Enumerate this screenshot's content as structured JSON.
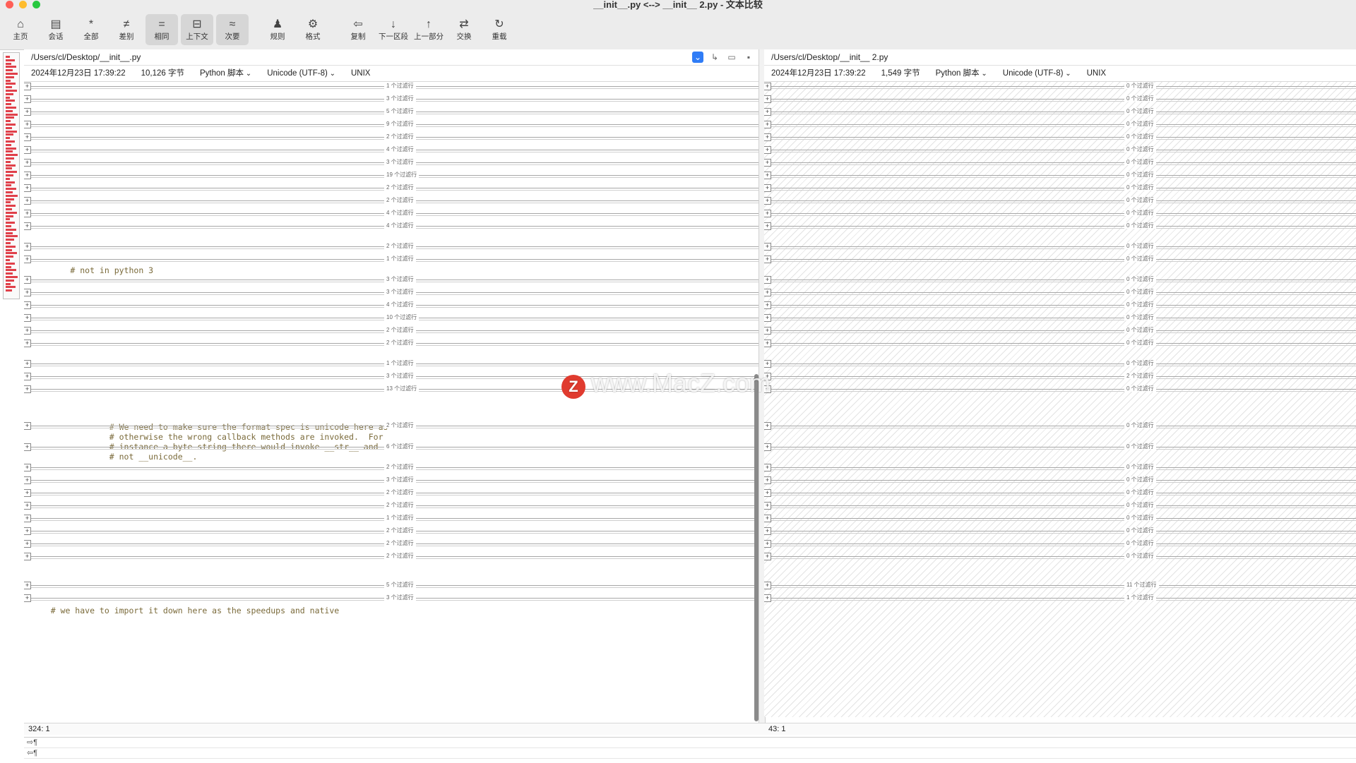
{
  "window": {
    "title": "__init__.py <--> __init__ 2.py - 文本比较"
  },
  "toolbar": [
    {
      "label": "主页",
      "icon": "home-icon",
      "glyph": "⌂",
      "active": false
    },
    {
      "label": "会话",
      "icon": "briefcase-icon",
      "glyph": "▤",
      "active": false
    },
    {
      "label": "全部",
      "icon": "asterisk-icon",
      "glyph": "*",
      "active": false
    },
    {
      "label": "差别",
      "icon": "not-equal-icon",
      "glyph": "≠",
      "active": false
    },
    {
      "label": "相同",
      "icon": "equal-icon",
      "glyph": "=",
      "active": true
    },
    {
      "label": "上下文",
      "icon": "context-icon",
      "glyph": "⊟",
      "active": true
    },
    {
      "label": "次要",
      "icon": "approx-icon",
      "glyph": "≈",
      "active": true
    },
    {
      "label": "规则",
      "icon": "rules-icon",
      "glyph": "♟",
      "active": false
    },
    {
      "label": "格式",
      "icon": "format-icon",
      "glyph": "⚙",
      "active": false
    },
    {
      "label": "复制",
      "icon": "copy-left-icon",
      "glyph": "⇦",
      "active": false
    },
    {
      "label": "下一区段",
      "icon": "arrow-down-icon",
      "glyph": "↓",
      "active": false
    },
    {
      "label": "上一部分",
      "icon": "arrow-up-icon",
      "glyph": "↑",
      "active": false
    },
    {
      "label": "交换",
      "icon": "swap-icon",
      "glyph": "⇄",
      "active": false
    },
    {
      "label": "重载",
      "icon": "reload-icon",
      "glyph": "↻",
      "active": false
    }
  ],
  "left": {
    "path": "/Users/cl/Desktop/__init__.py",
    "date": "2024年12月23日 17:39:22",
    "size": "10,126 字节",
    "format": "Python 脚本",
    "encoding": "Unicode (UTF-8)",
    "lineend": "UNIX",
    "status": "324: 1"
  },
  "right": {
    "path": "/Users/cl/Desktop/__init__ 2.py",
    "date": "2024年12月23日 17:39:22",
    "size": "1,549 字节",
    "format": "Python 脚本",
    "encoding": "Unicode (UTF-8)",
    "lineend": "UNIX",
    "status": "43: 1"
  },
  "left_folds": [
    "1 个过滤行",
    "3 个过滤行",
    "5 个过滤行",
    "9 个过滤行",
    "2 个过滤行",
    "4 个过滤行",
    "3 个过滤行",
    "19 个过滤行",
    "2 个过滤行",
    "2 个过滤行",
    "4 个过滤行",
    "4 个过滤行",
    "2 个过滤行",
    "1 个过滤行",
    "3 个过滤行",
    "3 个过滤行",
    "4 个过滤行",
    "10 个过滤行",
    "2 个过滤行",
    "2 个过滤行",
    "1 个过滤行",
    "3 个过滤行",
    "13 个过滤行",
    "2 个过滤行",
    "6 个过滤行",
    "2 个过滤行",
    "3 个过滤行",
    "2 个过滤行",
    "2 个过滤行",
    "1 个过滤行",
    "2 个过滤行",
    "2 个过滤行",
    "2 个过滤行",
    "5 个过滤行",
    "3 个过滤行"
  ],
  "right_folds": [
    "0 个过滤行",
    "0 个过滤行",
    "0 个过滤行",
    "0 个过滤行",
    "0 个过滤行",
    "0 个过滤行",
    "0 个过滤行",
    "0 个过滤行",
    "0 个过滤行",
    "0 个过滤行",
    "0 个过滤行",
    "0 个过滤行",
    "0 个过滤行",
    "0 个过滤行",
    "0 个过滤行",
    "0 个过滤行",
    "0 个过滤行",
    "0 个过滤行",
    "0 个过滤行",
    "0 个过滤行",
    "0 个过滤行",
    "2 个过滤行",
    "0 个过滤行",
    "0 个过滤行",
    "0 个过滤行",
    "0 个过滤行",
    "0 个过滤行",
    "0 个过滤行",
    "0 个过滤行",
    "0 个过滤行",
    "0 个过滤行",
    "0 个过滤行",
    "0 个过滤行",
    "11 个过滤行",
    "1 个过滤行"
  ],
  "code": {
    "comment1": "        # not in python 3",
    "comment2": "                # We need to make sure the format spec is unicode here as\n                # otherwise the wrong callback methods are invoked.  For\n                # instance a byte string there would invoke __str__ and\n                # not __unicode__.",
    "comment3": "    # we have to import it down here as the speedups and native"
  },
  "cursor_lines": [
    "⇨¶",
    "⇦¶"
  ],
  "watermark": "www.MacZ.com",
  "watermark_logo": "Z"
}
